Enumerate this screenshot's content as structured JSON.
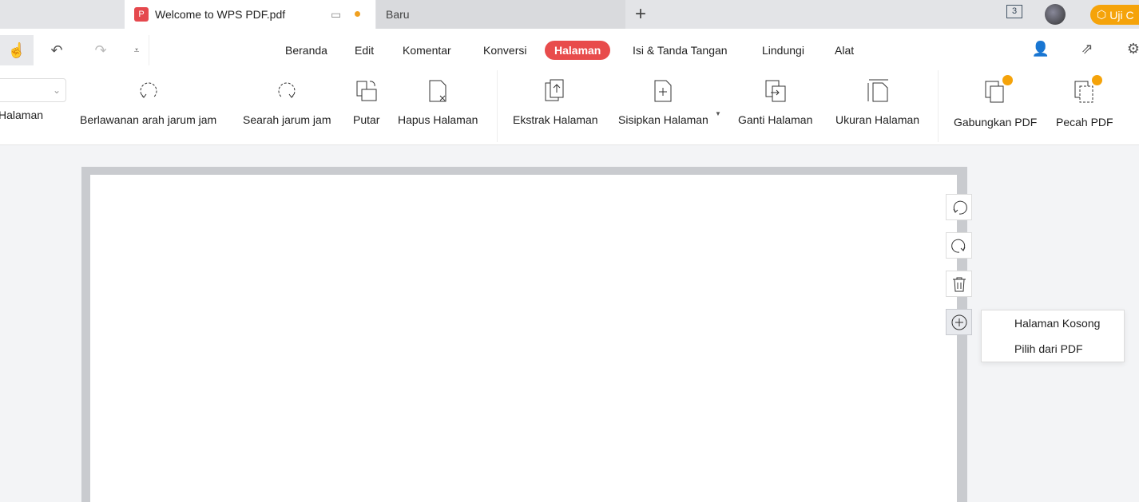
{
  "tabs": {
    "active": "Welcome to WPS PDF.pdf",
    "inactive": "Baru",
    "new": "+"
  },
  "titlebar": {
    "window_count": "3",
    "badge": "Uji C"
  },
  "menu": [
    "Beranda",
    "Edit",
    "Komentar",
    "Konversi",
    "Halaman",
    "Isi & Tanda Tangan",
    "Lindungi",
    "Alat"
  ],
  "toolbar": {
    "left_label": "Halaman",
    "tools": [
      "Berlawanan arah jarum jam",
      "Searah jarum jam",
      "Putar",
      "Hapus Halaman",
      "Ekstrak Halaman",
      "Sisipkan Halaman",
      "Ganti Halaman",
      "Ukuran Halaman",
      "Gabungkan PDF",
      "Pecah PDF"
    ]
  },
  "popup": [
    "Halaman Kosong",
    "Pilih dari PDF"
  ],
  "colors": {
    "accent": "#e84c4c",
    "premium": "#f5a30a"
  }
}
